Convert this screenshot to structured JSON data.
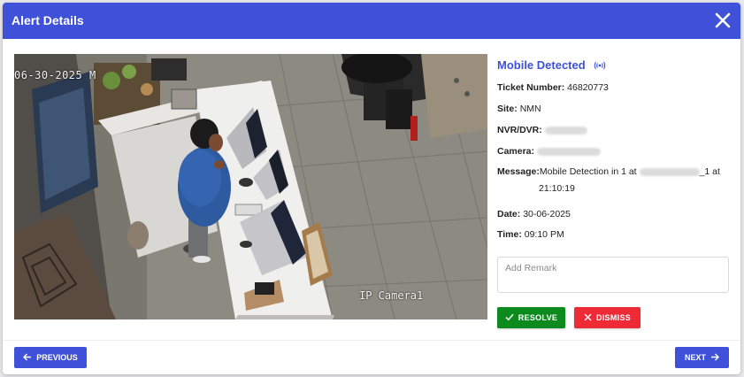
{
  "dialog": {
    "title": "Alert Details",
    "close_icon": "close-icon"
  },
  "camera": {
    "timestamp": "06-30-2025 M",
    "label": "IP Camera1"
  },
  "alert": {
    "type": "Mobile Detected",
    "type_icon": "signal-icon",
    "ticket_label": "Ticket Number:",
    "ticket_value": "46820773",
    "site_label": "Site:",
    "site_value": "NMN",
    "nvr_label": "NVR/DVR:",
    "camera_label": "Camera:",
    "message_label": "Message:",
    "message_prefix": "Mobile Detection in 1 at",
    "message_suffix": "_1 at",
    "message_time": "21:10:19",
    "date_label": "Date:",
    "date_value": "30-06-2025",
    "time_label": "Time:",
    "time_value": "09:10 PM"
  },
  "remark": {
    "placeholder": "Add Remark",
    "value": ""
  },
  "actions": {
    "resolve_label": "RESOLVE",
    "dismiss_label": "DISMISS"
  },
  "nav": {
    "previous_label": "PREVIOUS",
    "next_label": "NEXT"
  },
  "colors": {
    "primary": "#3f51d8",
    "resolve": "#0c8a1e",
    "dismiss": "#ee2a36"
  }
}
